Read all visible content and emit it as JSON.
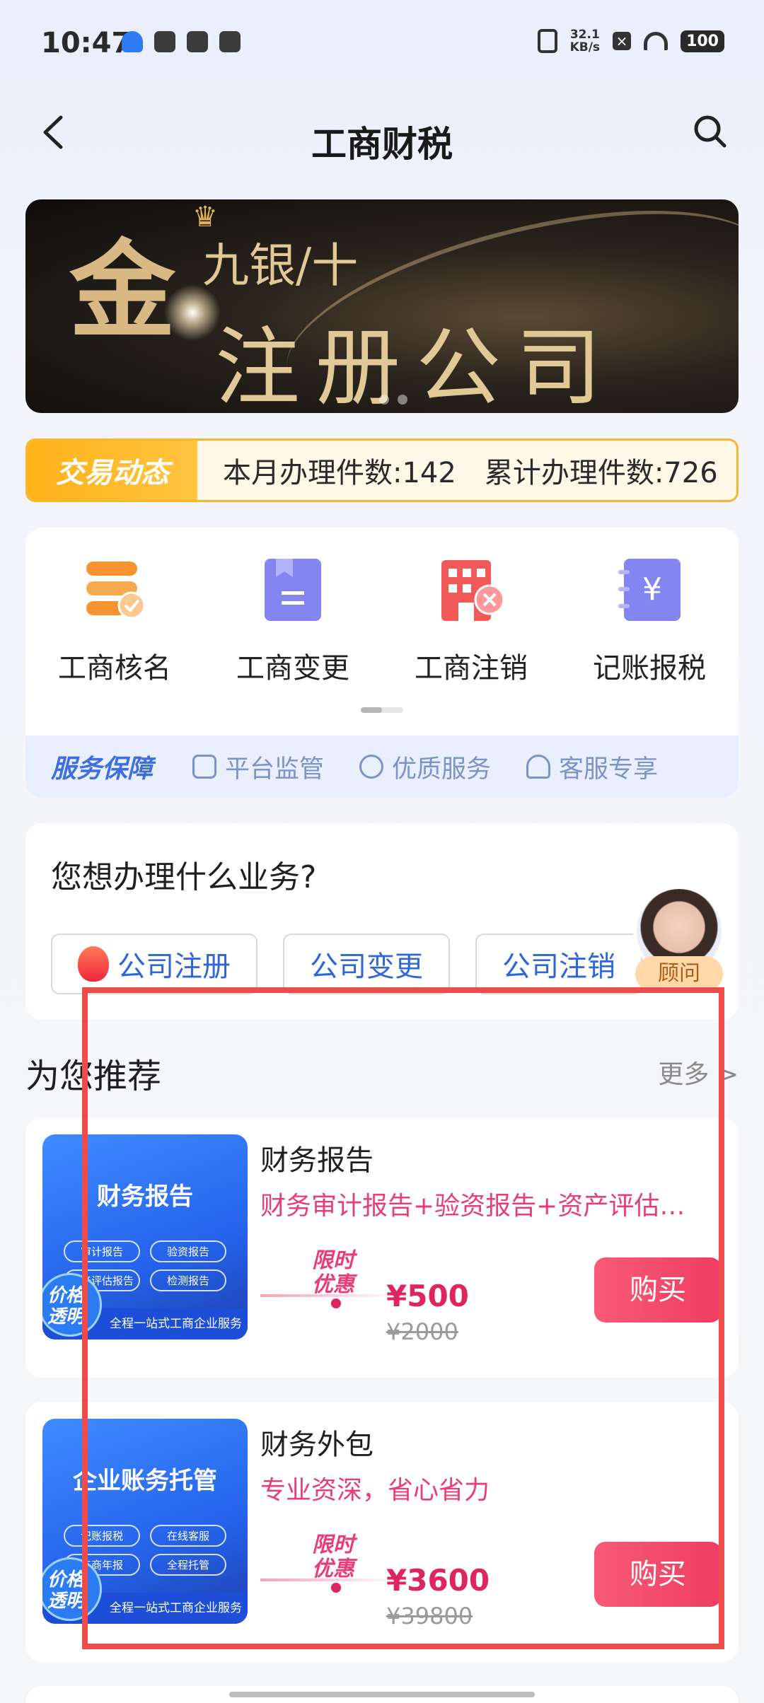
{
  "status_bar": {
    "time": "10:47",
    "net_speed_value": "32.1",
    "net_speed_unit": "KB/s",
    "battery": "100"
  },
  "nav": {
    "title": "工商财税",
    "back_icon": "chevron-left-icon",
    "search_icon": "search-icon"
  },
  "banner": {
    "line1_big": "金",
    "line1_rest": "九银/十",
    "line2": "注册公司"
  },
  "ticker": {
    "label": "交易动态",
    "monthly": "本月办理件数:142",
    "total": "累计办理件数:726"
  },
  "services": {
    "items": [
      {
        "label": "工商核名",
        "icon": "name-check-icon",
        "color": "#f7932e"
      },
      {
        "label": "工商变更",
        "icon": "bookmark-doc-icon",
        "color": "#7c7cf0"
      },
      {
        "label": "工商注销",
        "icon": "building-cancel-icon",
        "color": "#f25a5a"
      },
      {
        "label": "记账报税",
        "icon": "yen-notebook-icon",
        "color": "#7c7cf0"
      }
    ],
    "guarantee": {
      "title": "服务保障",
      "items": [
        {
          "label": "平台监管",
          "icon": "shield-check-icon"
        },
        {
          "label": "优质服务",
          "icon": "heart-hand-icon"
        },
        {
          "label": "客服专享",
          "icon": "headset-icon"
        }
      ]
    }
  },
  "business": {
    "question": "您想办理什么业务?",
    "tags": [
      "公司注册",
      "公司变更",
      "公司注销"
    ]
  },
  "advisor": {
    "label": "顾问"
  },
  "recommend": {
    "title": "为您推荐",
    "more": "更多 >"
  },
  "products": [
    {
      "name": "财务报告",
      "desc": "财务审计报告+验资报告+资产评估…",
      "thumb_title": "财务报告",
      "thumb_tags": [
        "审计报告",
        "验资报告",
        "资产评估报告",
        "检测报告"
      ],
      "thumb_footer": "全程一站式工商企业服务",
      "thumb_badge": "价格透明",
      "promo_tag": "限时优惠",
      "price": "¥500",
      "original_price": "¥2000",
      "buy_label": "购买"
    },
    {
      "name": "财务外包",
      "desc": "专业资深，省心省力",
      "thumb_title": "企业账务托管",
      "thumb_tags": [
        "记账报税",
        "在线客服",
        "工商年报",
        "全程托管"
      ],
      "thumb_footer": "全程一站式工商企业服务",
      "thumb_badge": "价格透明",
      "promo_tag": "限时优惠",
      "price": "¥3600",
      "original_price": "¥39800",
      "buy_label": "购买"
    }
  ],
  "colors": {
    "accent_blue": "#2f66d8",
    "price_red": "#e0245e",
    "highlight_red": "#ef4b4b",
    "ticker_orange": "#ffb319"
  }
}
